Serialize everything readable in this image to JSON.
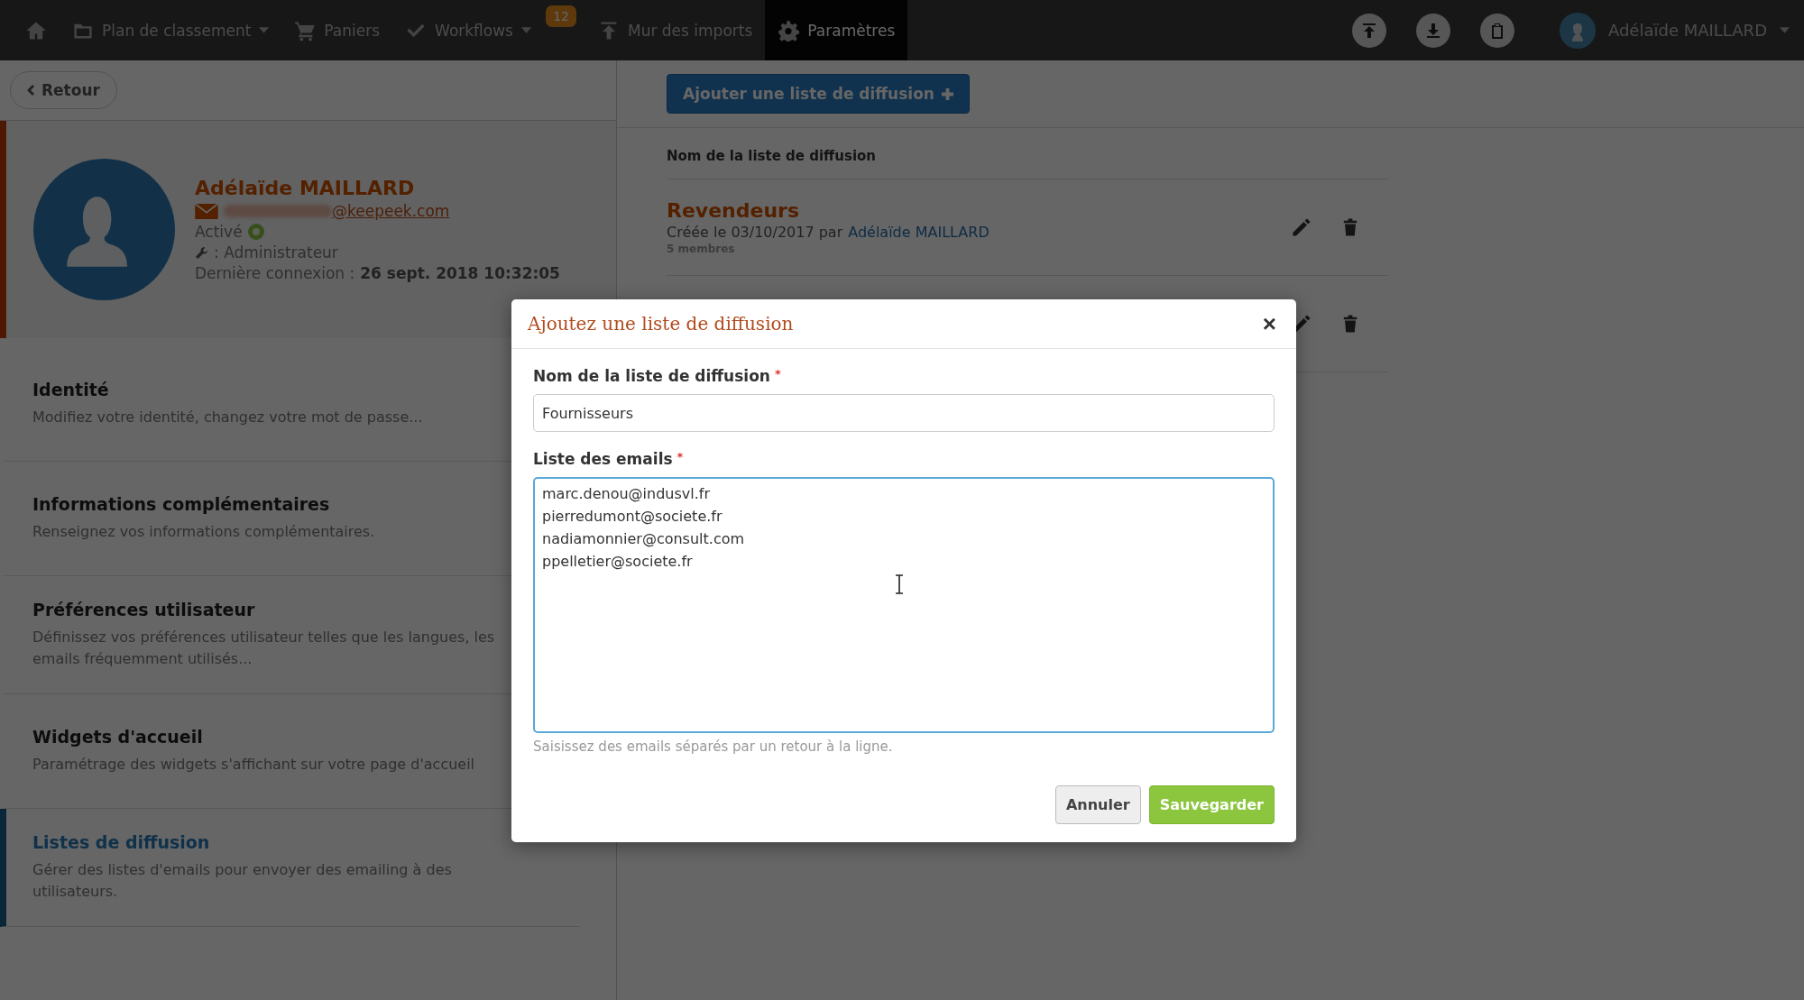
{
  "topbar": {
    "nav": [
      {
        "kind": "link",
        "selected": false
      },
      {
        "kind": "dropdown",
        "label": "Plan de classement",
        "selected": false
      },
      {
        "kind": "link",
        "label": "Paniers",
        "selected": false
      },
      {
        "kind": "dropdown",
        "label": "Workflows",
        "badge": "12",
        "selected": false
      },
      {
        "kind": "link",
        "label": "Mur des imports",
        "selected": false
      },
      {
        "kind": "link",
        "label": "Paramètres",
        "selected": true
      }
    ],
    "user": {
      "name": "Adélaïde MAILLARD"
    }
  },
  "back_button": "Retour",
  "profile": {
    "name": "Adélaïde MAILLARD",
    "email": "@keepeek.com",
    "status": "Activé",
    "role": ": Administrateur",
    "last_login_label": "Dernière connexion :",
    "last_login": "26 sept. 2018 10:32:05"
  },
  "sidebar": {
    "items": [
      {
        "title": "Identité",
        "description": "Modifiez votre identité, changez votre mot de passe...",
        "selected": false
      },
      {
        "title": "Informations complémentaires",
        "description": "Renseignez vos informations complémentaires.",
        "selected": false
      },
      {
        "title": "Préférences utilisateur",
        "description": "Définissez vos préférences utilisateur telles que les langues, les emails fréquemment utilisés...",
        "selected": false
      },
      {
        "title": "Widgets d'accueil",
        "description": "Paramétrage des widgets s'affichant sur votre page d'accueil",
        "selected": false
      },
      {
        "title": "Listes de diffusion",
        "description": "Gérer des listes d'emails pour envoyer des emailing à des utilisateurs.",
        "selected": true
      }
    ]
  },
  "content": {
    "add_button": "Ajouter une liste de diffusion",
    "column_header": "Nom de la liste de diffusion",
    "rows": [
      {
        "kind": "full",
        "title": "Revendeurs",
        "created": "Créée le 03/10/2017 par",
        "author": "Adélaïde MAILLARD",
        "members": "5 membres"
      },
      {
        "kind": "covered"
      }
    ]
  },
  "modal": {
    "title": "Ajoutez une liste de diffusion",
    "close": "×",
    "fields": [
      {
        "kind": "input",
        "label": "Nom de la liste de diffusion",
        "required_mark": "*",
        "value": "Fournisseurs"
      },
      {
        "kind": "textarea",
        "label": "Liste des emails",
        "required_mark": "*",
        "lines": [
          "marc.denou@indusvl.fr",
          "pierredumont@societe.fr",
          "nadiamonnier@consult.com",
          "ppelletier@societe.fr"
        ],
        "help": "Saisissez des emails séparés par un retour à la ligne."
      }
    ],
    "buttons": [
      {
        "kind": "cancel",
        "label": "Annuler"
      },
      {
        "kind": "primary",
        "label": "Sauvegarder"
      }
    ]
  }
}
